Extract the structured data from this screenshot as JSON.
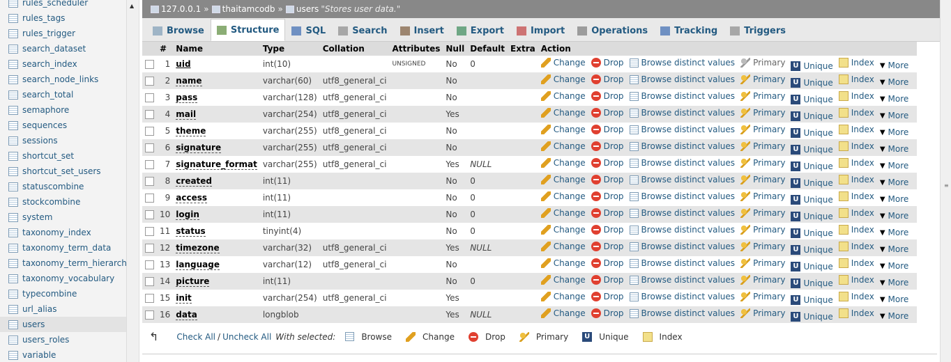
{
  "sidebar": {
    "tables": [
      "rules_scheduler",
      "rules_tags",
      "rules_trigger",
      "search_dataset",
      "search_index",
      "search_node_links",
      "search_total",
      "semaphore",
      "sequences",
      "sessions",
      "shortcut_set",
      "shortcut_set_users",
      "statuscombine",
      "stockcombine",
      "system",
      "taxonomy_index",
      "taxonomy_term_data",
      "taxonomy_term_hierarchy",
      "taxonomy_vocabulary",
      "typecombine",
      "url_alias",
      "users",
      "users_roles",
      "variable"
    ],
    "selected": "users"
  },
  "breadcrumb": {
    "server": "127.0.0.1",
    "database": "thaitamcodb",
    "table": "users",
    "comment": "\"Stores user data.\"",
    "separator": "»"
  },
  "tabs": [
    {
      "label": "Browse",
      "icon": "browse-icon"
    },
    {
      "label": "Structure",
      "icon": "structure-icon",
      "active": true
    },
    {
      "label": "SQL",
      "icon": "sql-icon"
    },
    {
      "label": "Search",
      "icon": "search-icon"
    },
    {
      "label": "Insert",
      "icon": "insert-icon"
    },
    {
      "label": "Export",
      "icon": "export-icon"
    },
    {
      "label": "Import",
      "icon": "import-icon"
    },
    {
      "label": "Operations",
      "icon": "operations-icon"
    },
    {
      "label": "Tracking",
      "icon": "tracking-icon"
    },
    {
      "label": "Triggers",
      "icon": "triggers-icon"
    }
  ],
  "columns": [
    "#",
    "Name",
    "Type",
    "Collation",
    "Attributes",
    "Null",
    "Default",
    "Extra",
    "Action"
  ],
  "actions": {
    "change": "Change",
    "drop": "Drop",
    "browse_distinct": "Browse distinct values",
    "primary": "Primary",
    "unique": "Unique",
    "index": "Index",
    "more": "More"
  },
  "rows": [
    {
      "n": "1",
      "name": "uid",
      "type": "int(10)",
      "collation": "",
      "attributes": "UNSIGNED",
      "null": "No",
      "default": "0",
      "extra": "",
      "primary": true
    },
    {
      "n": "2",
      "name": "name",
      "type": "varchar(60)",
      "collation": "utf8_general_ci",
      "attributes": "",
      "null": "No",
      "default": "",
      "extra": ""
    },
    {
      "n": "3",
      "name": "pass",
      "type": "varchar(128)",
      "collation": "utf8_general_ci",
      "attributes": "",
      "null": "No",
      "default": "",
      "extra": ""
    },
    {
      "n": "4",
      "name": "mail",
      "type": "varchar(254)",
      "collation": "utf8_general_ci",
      "attributes": "",
      "null": "Yes",
      "default": "",
      "extra": ""
    },
    {
      "n": "5",
      "name": "theme",
      "type": "varchar(255)",
      "collation": "utf8_general_ci",
      "attributes": "",
      "null": "No",
      "default": "",
      "extra": ""
    },
    {
      "n": "6",
      "name": "signature",
      "type": "varchar(255)",
      "collation": "utf8_general_ci",
      "attributes": "",
      "null": "No",
      "default": "",
      "extra": ""
    },
    {
      "n": "7",
      "name": "signature_format",
      "type": "varchar(255)",
      "collation": "utf8_general_ci",
      "attributes": "",
      "null": "Yes",
      "default": "NULL",
      "extra": ""
    },
    {
      "n": "8",
      "name": "created",
      "type": "int(11)",
      "collation": "",
      "attributes": "",
      "null": "No",
      "default": "0",
      "extra": ""
    },
    {
      "n": "9",
      "name": "access",
      "type": "int(11)",
      "collation": "",
      "attributes": "",
      "null": "No",
      "default": "0",
      "extra": ""
    },
    {
      "n": "10",
      "name": "login",
      "type": "int(11)",
      "collation": "",
      "attributes": "",
      "null": "No",
      "default": "0",
      "extra": ""
    },
    {
      "n": "11",
      "name": "status",
      "type": "tinyint(4)",
      "collation": "",
      "attributes": "",
      "null": "No",
      "default": "0",
      "extra": ""
    },
    {
      "n": "12",
      "name": "timezone",
      "type": "varchar(32)",
      "collation": "utf8_general_ci",
      "attributes": "",
      "null": "Yes",
      "default": "NULL",
      "extra": ""
    },
    {
      "n": "13",
      "name": "language",
      "type": "varchar(12)",
      "collation": "utf8_general_ci",
      "attributes": "",
      "null": "No",
      "default": "",
      "extra": ""
    },
    {
      "n": "14",
      "name": "picture",
      "type": "int(11)",
      "collation": "",
      "attributes": "",
      "null": "No",
      "default": "0",
      "extra": ""
    },
    {
      "n": "15",
      "name": "init",
      "type": "varchar(254)",
      "collation": "utf8_general_ci",
      "attributes": "",
      "null": "Yes",
      "default": "",
      "extra": ""
    },
    {
      "n": "16",
      "name": "data",
      "type": "longblob",
      "collation": "",
      "attributes": "",
      "null": "Yes",
      "default": "NULL",
      "extra": ""
    }
  ],
  "with_selected": {
    "check_all": "Check All",
    "separator": "/",
    "uncheck_all": "Uncheck All",
    "label": "With selected:",
    "items": [
      "Browse",
      "Change",
      "Drop",
      "Primary",
      "Unique",
      "Index"
    ]
  },
  "colors": {
    "link": "#235a81",
    "breadcrumb_bg": "#888888",
    "row_even": "#e5e5e5"
  }
}
